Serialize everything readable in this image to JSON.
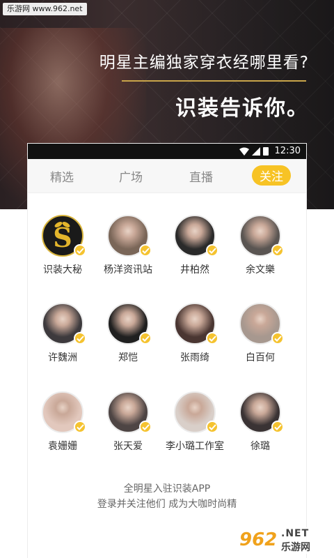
{
  "banner": {
    "watermark": "乐游网 www.962.net",
    "headline": "明星主编独家穿衣经哪里看?",
    "slogan": "识装告诉你。"
  },
  "statusbar": {
    "time": "12:30",
    "icons": [
      "wifi-icon",
      "signal-icon",
      "battery-icon"
    ]
  },
  "tabs": [
    {
      "label": "精选",
      "active": false
    },
    {
      "label": "广场",
      "active": false
    },
    {
      "label": "直播",
      "active": false
    },
    {
      "label": "关注",
      "active": true
    }
  ],
  "accent_color": "#f7c325",
  "celebrities": [
    {
      "name": "识装大秘",
      "verified": true,
      "avatar": "logo-s",
      "color": "#1a1a1a"
    },
    {
      "name": "杨洋资讯站",
      "verified": true,
      "avatar": "photo",
      "color": "#7a6658"
    },
    {
      "name": "井柏然",
      "verified": true,
      "avatar": "photo",
      "color": "#2a2a2a"
    },
    {
      "name": "余文樂",
      "verified": true,
      "avatar": "photo",
      "color": "#5a5552"
    },
    {
      "name": "许魏洲",
      "verified": true,
      "avatar": "photo",
      "color": "#3d3a3d"
    },
    {
      "name": "郑恺",
      "verified": true,
      "avatar": "photo",
      "color": "#202020"
    },
    {
      "name": "张雨绮",
      "verified": true,
      "avatar": "photo",
      "color": "#4a3632"
    },
    {
      "name": "白百何",
      "verified": true,
      "avatar": "photo",
      "color": "#a7988f"
    },
    {
      "name": "袁姗姗",
      "verified": true,
      "avatar": "photo",
      "color": "#e2c8bd"
    },
    {
      "name": "张天爱",
      "verified": true,
      "avatar": "photo",
      "color": "#4e4544"
    },
    {
      "name": "李小璐工作室",
      "verified": true,
      "avatar": "photo",
      "color": "#d9cfc9"
    },
    {
      "name": "徐璐",
      "verified": true,
      "avatar": "photo",
      "color": "#3a3334"
    }
  ],
  "footer": {
    "line1": "全明星入驻识装APP",
    "line2": "登录并关注他们 成为大咖时尚精"
  },
  "watermark_bottom": {
    "num": "962",
    "net": ".NET",
    "cn": "乐游网"
  }
}
